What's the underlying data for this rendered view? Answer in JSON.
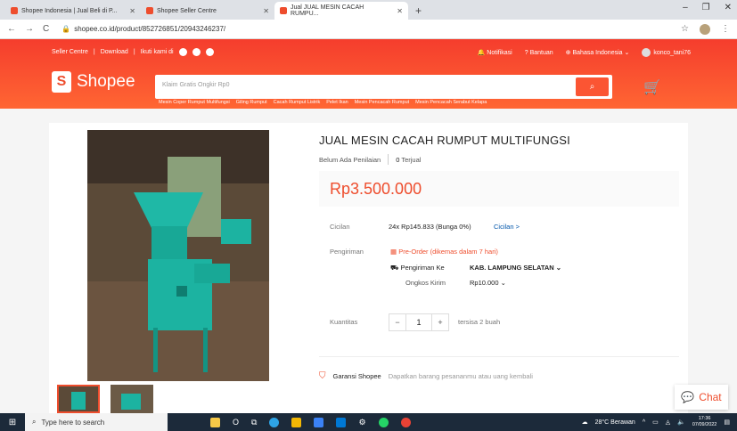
{
  "browser": {
    "tabs": [
      {
        "title": "Shopee Indonesia | Jual Beli di P..."
      },
      {
        "title": "Shopee Seller Centre"
      },
      {
        "title": "Jual JUAL MESIN CACAH RUMPU..."
      }
    ],
    "url": "shopee.co.id/product/852726851/20943246237/"
  },
  "header": {
    "topnav": [
      "Seller Centre",
      "Download",
      "Ikuti kami di"
    ],
    "topright": [
      "Notifikasi",
      "Bantuan",
      "Bahasa Indonesia"
    ],
    "username": "konco_tani76",
    "brand": "Shopee",
    "search_placeholder": "Klaim Gratis Ongkir Rp0",
    "keywords": [
      "Mesin Coper Rumput Multifungsi",
      "Giling Rumput",
      "Cacah Rumput Listrik",
      "Pelet Ikan",
      "Mesin Pencacah Rumput",
      "Mesin Pencacah Serabut Kelapa"
    ]
  },
  "product": {
    "title": "JUAL MESIN CACAH RUMPUT MULTIFUNGSI",
    "rating_text": "Belum Ada Penilaian",
    "sold_count": "0",
    "sold_label": "Terjual",
    "price": "Rp3.500.000",
    "installment_label": "Cicilan",
    "installment_value": "24x Rp145.833 (Bunga 0%)",
    "installment_link": "Cicilan >",
    "shipping_label": "Pengiriman",
    "preorder_text": "Pre-Order (dikemas dalam 7 hari)",
    "ship_to_label": "Pengiriman Ke",
    "ship_to_value": "KAB. LAMPUNG SELATAN",
    "ship_cost_label": "Ongkos Kirim",
    "ship_cost_value": "Rp10.000",
    "quantity_label": "Kuantitas",
    "quantity": "1",
    "stock_text": "tersisa 2 buah",
    "guarantee_title": "Garansi Shopee",
    "guarantee_desc": "Dapatkan barang pesananmu atau uang kembali"
  },
  "chat_label": "Chat",
  "taskbar": {
    "search_placeholder": "Type here to search",
    "weather": "28°C Berawan",
    "time": "17:36",
    "date": "07/09/2022"
  }
}
